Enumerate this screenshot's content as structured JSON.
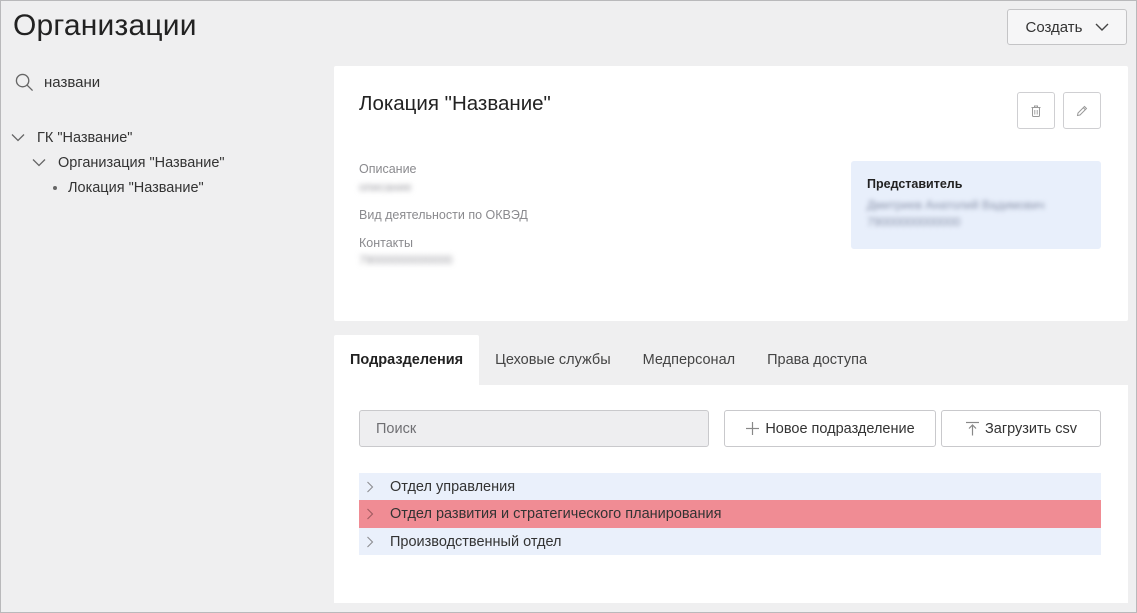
{
  "header": {
    "title": "Организации",
    "create_label": "Создать"
  },
  "sidebar": {
    "search_value": "названи",
    "tree": [
      {
        "label": "ГК \"Название\"",
        "level": 1,
        "expanded": true
      },
      {
        "label": "Организация \"Название\"",
        "level": 2,
        "expanded": true
      },
      {
        "label": "Локация \"Название\"",
        "level": 3
      }
    ]
  },
  "card": {
    "title": "Локация \"Название\"",
    "description_label": "Описание",
    "description_value": "описание",
    "okved_label": "Вид деятельности по ОКВЭД",
    "contacts_label": "Контакты",
    "contacts_value": "79000000000000",
    "representative": {
      "title": "Представитель",
      "value": "Дмитриев Анатолий Вадимович 79000000000000"
    }
  },
  "tabs": [
    {
      "label": "Подразделения",
      "active": true
    },
    {
      "label": "Цеховые службы",
      "active": false
    },
    {
      "label": "Медперсонал",
      "active": false
    },
    {
      "label": "Права доступа",
      "active": false
    }
  ],
  "panel": {
    "search_placeholder": "Поиск",
    "new_dept_label": "Новое подразделение",
    "upload_label": "Загрузить csv",
    "departments": [
      {
        "label": "Отдел управления",
        "highlighted": false
      },
      {
        "label": "Отдел развития и стратегического планирования",
        "highlighted": true
      },
      {
        "label": "Производственный отдел",
        "highlighted": false
      }
    ]
  },
  "colors": {
    "highlight_row": "#f08c94",
    "row_bg": "#eaf0fb",
    "rep_box": "#e8effb",
    "page_bg": "#efeff0"
  }
}
